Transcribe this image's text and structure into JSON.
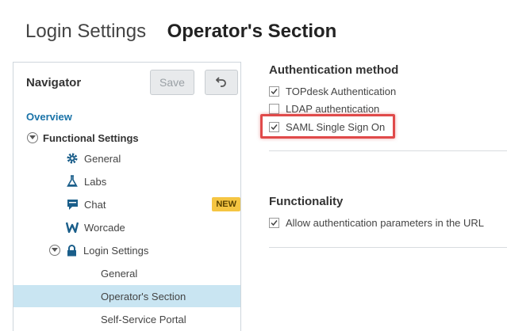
{
  "header": {
    "crumb": "Login Settings",
    "current": "Operator's Section"
  },
  "navigator": {
    "title": "Navigator",
    "save_label": "Save",
    "undo_icon": "undo-icon",
    "overview": "Overview",
    "functional_settings": "Functional Settings",
    "items": [
      {
        "label": "General",
        "icon": "gear-icon"
      },
      {
        "label": "Labs",
        "icon": "flask-icon"
      },
      {
        "label": "Chat",
        "icon": "chat-icon",
        "badge": "NEW"
      },
      {
        "label": "Worcade",
        "icon": "worcade-icon"
      }
    ],
    "login_settings": "Login Settings",
    "login_children": [
      {
        "label": "General"
      },
      {
        "label": "Operator's Section",
        "selected": true
      },
      {
        "label": "Self-Service Portal"
      }
    ]
  },
  "auth": {
    "title": "Authentication method",
    "options": [
      {
        "label": "TOPdesk Authentication",
        "checked": true
      },
      {
        "label": "LDAP authentication",
        "checked": false
      },
      {
        "label": "SAML Single Sign On",
        "checked": true
      }
    ]
  },
  "functionality": {
    "title": "Functionality",
    "options": [
      {
        "label": "Allow authentication parameters in the URL",
        "checked": true
      }
    ]
  },
  "colors": {
    "accent": "#1a73a8",
    "selected_bg": "#c9e5f2",
    "badge": "#f5c542",
    "highlight": "#e04a4a"
  }
}
